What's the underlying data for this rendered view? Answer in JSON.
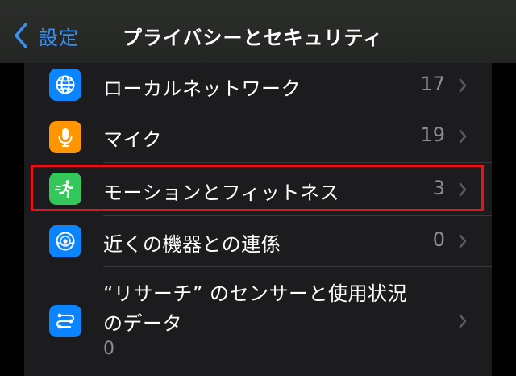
{
  "nav": {
    "back_label": "設定",
    "title": "プライバシーとセキュリティ"
  },
  "rows": [
    {
      "label": "ローカルネットワーク",
      "count": "17",
      "icon": "globe-network-icon",
      "icon_bg": "#0a84ff"
    },
    {
      "label": "マイク",
      "count": "19",
      "icon": "microphone-icon",
      "icon_bg": "#ff9500"
    },
    {
      "label": "モーションとフィットネス",
      "count": "3",
      "icon": "running-person-icon",
      "icon_bg": "#34c759"
    },
    {
      "label": "近くの機器との連係",
      "count": "0",
      "icon": "nearby-devices-icon",
      "icon_bg": "#0a84ff"
    },
    {
      "label_line1": "“リサーチ” のセンサーと使用状況",
      "label_line2": "のデータ",
      "count": "0",
      "icon": "research-sensors-icon",
      "icon_bg": "#0a84ff"
    }
  ],
  "colors": {
    "accent": "#3a8ff0",
    "highlight_border": "#e3141b"
  }
}
